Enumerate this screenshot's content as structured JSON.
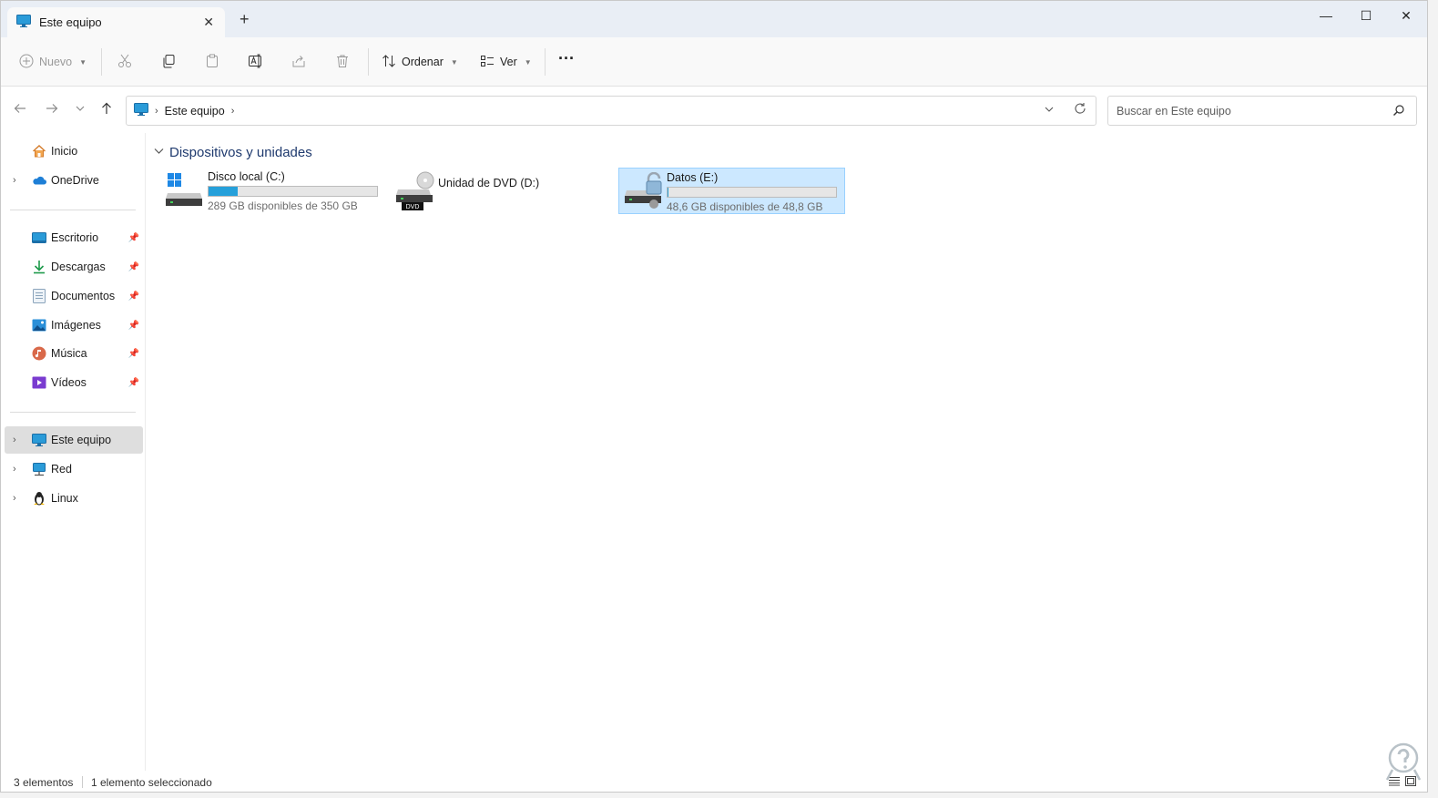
{
  "window": {
    "tab_title": "Este equipo",
    "close_tab": "✕",
    "new_tab": "+",
    "minimize": "—",
    "maximize": "☐",
    "close": "✕"
  },
  "toolbar": {
    "new_label": "Nuevo",
    "sort_label": "Ordenar",
    "view_label": "Ver",
    "more_label": "···"
  },
  "address": {
    "crumb": "Este equipo",
    "chevron": "›",
    "search_placeholder": "Buscar en Este equipo"
  },
  "sidebar": {
    "items": [
      {
        "label": "Inicio",
        "icon": "home-icon"
      },
      {
        "label": "OneDrive",
        "icon": "onedrive-icon"
      },
      {
        "label": "Escritorio",
        "icon": "desktop-icon"
      },
      {
        "label": "Descargas",
        "icon": "downloads-icon"
      },
      {
        "label": "Documentos",
        "icon": "documents-icon"
      },
      {
        "label": "Imágenes",
        "icon": "pictures-icon"
      },
      {
        "label": "Música",
        "icon": "music-icon"
      },
      {
        "label": "Vídeos",
        "icon": "videos-icon"
      },
      {
        "label": "Este equipo",
        "icon": "this-pc-icon"
      },
      {
        "label": "Red",
        "icon": "network-icon"
      },
      {
        "label": "Linux",
        "icon": "linux-icon"
      }
    ]
  },
  "content": {
    "group_title": "Dispositivos y unidades",
    "drives": [
      {
        "name": "Disco local (C:)",
        "free": "289 GB disponibles de 350 GB",
        "used_fraction": 0.174,
        "icon": "windows-drive-icon"
      },
      {
        "name": "Unidad de DVD (D:)",
        "icon": "dvd-drive-icon",
        "badge": "DVD"
      },
      {
        "name": "Datos (E:)",
        "free": "48,6 GB disponibles de 48,8 GB",
        "used_fraction": 0.004,
        "icon": "locked-drive-icon",
        "selected": true
      }
    ]
  },
  "status": {
    "count": "3 elementos",
    "selection": "1 elemento seleccionado"
  },
  "colors": {
    "accent": "#26a0da",
    "selection_bg": "#cce8ff",
    "group_title": "#1f3a6e"
  }
}
